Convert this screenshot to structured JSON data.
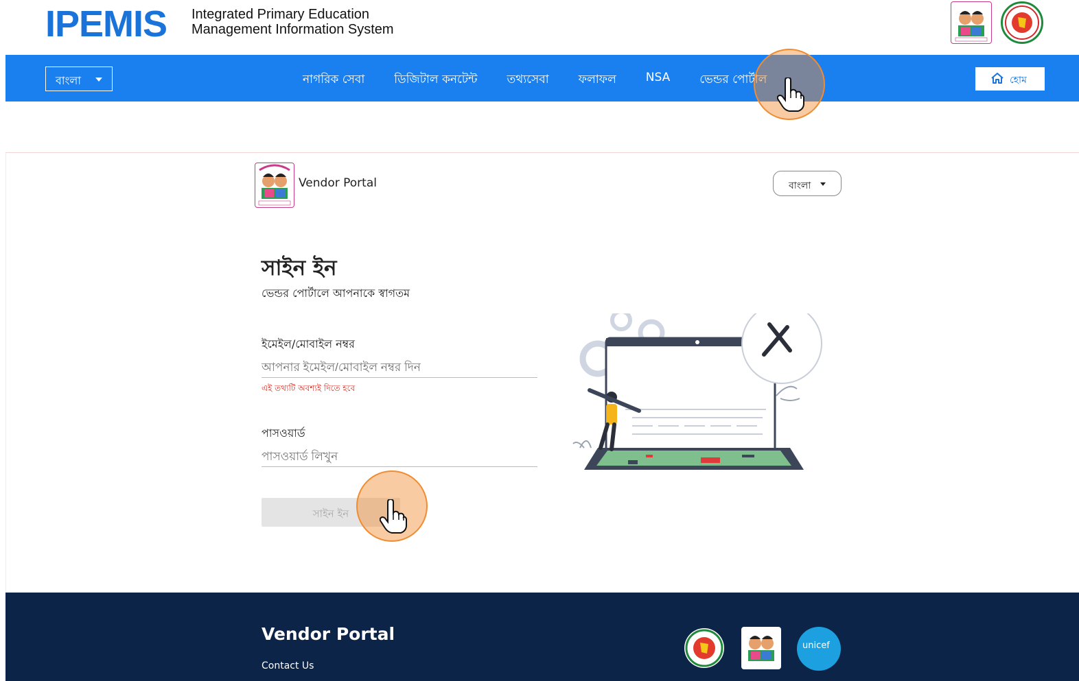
{
  "header": {
    "brand": "IPEMIS",
    "subtitle_line1": "Integrated Primary Education",
    "subtitle_line2": "Management Information System"
  },
  "navbar": {
    "language": "বাংলা",
    "items": [
      {
        "label": "নাগরিক সেবা"
      },
      {
        "label": "ডিজিটাল কনটেন্ট"
      },
      {
        "label": "তথ্যসেবা"
      },
      {
        "label": "ফলাফল"
      },
      {
        "label": "NSA"
      },
      {
        "label": "ভেন্ডর পোর্টাল"
      }
    ],
    "home_label": "হোম"
  },
  "vendor_portal": {
    "title": "Vendor Portal",
    "language": "বাংলা",
    "heading": "সাইন ইন",
    "subheading": "ভেন্ডর পোর্টালে আপনাকে স্বাগতম",
    "email_label": "ইমেইল/মোবাইল নম্বর",
    "email_placeholder": "আপনার ইমেইল/মোবাইল নম্বর দিন",
    "email_error": "এই তথ্যটি অবশ্যই দিতে হবে",
    "password_label": "পাসওয়ার্ড",
    "password_placeholder": "পাসওয়ার্ড লিখুন",
    "signin_button": "সাইন ইন"
  },
  "footer": {
    "title": "Vendor Portal",
    "contact": "Contact Us",
    "unicef_label": "unicef"
  },
  "colors": {
    "brand_blue": "#1a73d9",
    "nav_blue": "#1a80f0",
    "footer_navy": "#0b2447",
    "error_red": "#d93025",
    "cursor_orange": "#f08c32"
  }
}
